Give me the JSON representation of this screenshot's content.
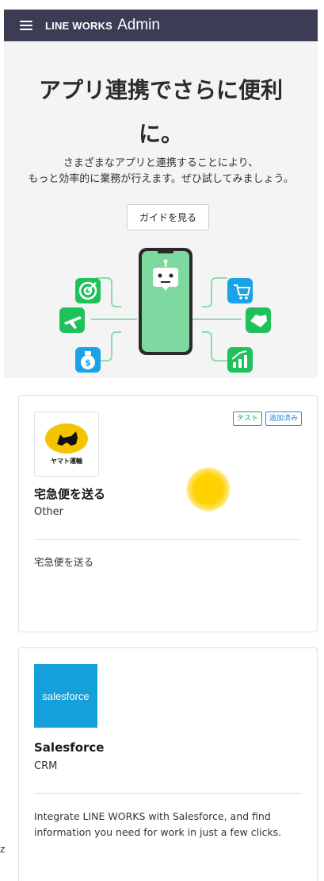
{
  "header": {
    "brand": "LINE WORKS",
    "product": "Admin"
  },
  "hero": {
    "title_line1": "アプリ連携でさらに便利",
    "title_line2": "に。",
    "desc_line1": "さまざまなアプリと連携することにより、",
    "desc_line2": "もっと効率的に業務が行えます。ぜひ試してみましょう。",
    "guide_button": "ガイドを見る"
  },
  "illustration": {
    "icons": [
      "target-icon",
      "plane-icon",
      "money-bag-icon",
      "cart-icon",
      "handshake-icon",
      "chart-icon",
      "robot-icon"
    ],
    "colors": {
      "green": "#1fc15a",
      "blue": "#1aa2e6",
      "phone": "#7ed9a0"
    }
  },
  "apps": [
    {
      "logo_text": "ヤマト運輸",
      "name": "宅急便を送る",
      "category": "Other",
      "badges": [
        "テスト",
        "追加済み"
      ],
      "description": "宅急便を送る"
    },
    {
      "logo_text": "salesforce",
      "name": "Salesforce",
      "category": "CRM",
      "description_line1": "Integrate LINE WORKS with Salesforce, and find",
      "description_line2": "information you need for work in just a few clicks."
    }
  ],
  "edge_fragment": "z"
}
